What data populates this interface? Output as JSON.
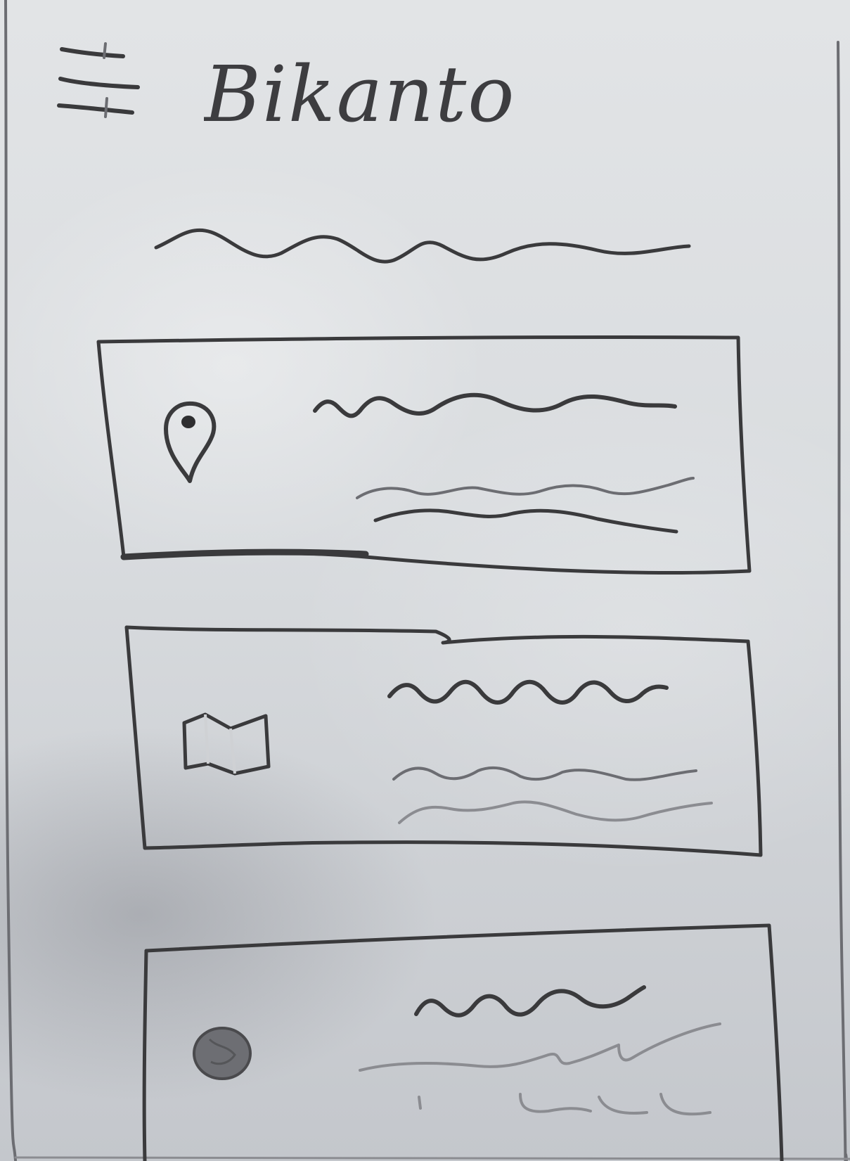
{
  "header": {
    "app_title": "Bikanto",
    "menu_icon": "hamburger-menu-icon"
  },
  "cards": [
    {
      "icon": "map-pin-icon"
    },
    {
      "icon": "folded-map-icon"
    },
    {
      "icon": "globe-icon"
    }
  ]
}
